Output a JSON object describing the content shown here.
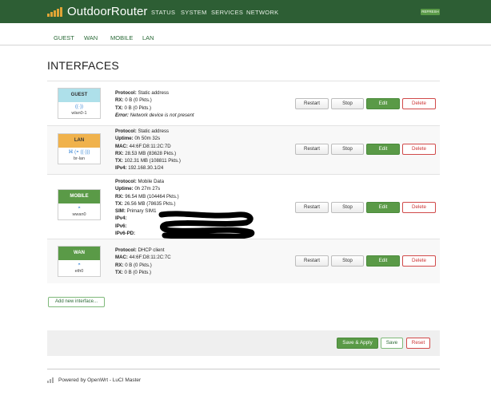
{
  "header": {
    "brand": "OutdoorRouter",
    "nav": [
      "STATUS",
      "SYSTEM",
      "SERVICES",
      "NETWORK"
    ],
    "refresh": "REFRESH"
  },
  "tabs": [
    "GUEST",
    "WAN",
    "MOBILE",
    "LAN"
  ],
  "page_title": "INTERFACES",
  "interfaces": [
    {
      "name": "GUEST",
      "color": "#aee0ea",
      "device": "wlan0-1",
      "icons": "((·))",
      "lines": [
        {
          "k": "Protocol:",
          "v": " Static address"
        },
        {
          "k": "RX:",
          "v": " 0 B (0 Pkts.)"
        },
        {
          "k": "TX:",
          "v": " 0 B (0 Pkts.)"
        },
        {
          "k": "Error:",
          "v": " Network device is not present"
        }
      ]
    },
    {
      "name": "LAN",
      "color": "#f0b24c",
      "device": "br-lan",
      "icons": "⌘ (◓ ((·)))",
      "lines": [
        {
          "k": "Protocol:",
          "v": " Static address"
        },
        {
          "k": "Uptime:",
          "v": " 0h 50m 32s"
        },
        {
          "k": "MAC:",
          "v": " 44:6F:D8:11:2C:7D"
        },
        {
          "k": "RX:",
          "v": " 28.53 MB (83628 Pkts.)"
        },
        {
          "k": "TX:",
          "v": " 102.31 MB (108811 Pkts.)"
        },
        {
          "k": "IPv4:",
          "v": " 192.168.30.1/24"
        }
      ]
    },
    {
      "name": "MOBILE",
      "color": "#5a9a47",
      "device": "wwan0",
      "icons": "◓",
      "lines": [
        {
          "k": "Protocol:",
          "v": " Mobile Data"
        },
        {
          "k": "Uptime:",
          "v": " 0h 27m 27s"
        },
        {
          "k": "RX:",
          "v": " 96.54 MB (104464 Pkts.)"
        },
        {
          "k": "TX:",
          "v": " 26.56 MB (78635 Pkts.)"
        },
        {
          "k": "SIM:",
          "v": " Primary SIM1"
        },
        {
          "k": "IPv4:",
          "v": ""
        },
        {
          "k": "IPv6:",
          "v": ""
        },
        {
          "k": "IPv6-PD:",
          "v": ""
        }
      ]
    },
    {
      "name": "WAN",
      "color": "#5a9a47",
      "device": "eth0",
      "icons": "◓",
      "lines": [
        {
          "k": "Protocol:",
          "v": " DHCP client"
        },
        {
          "k": "MAC:",
          "v": " 44:6F:D8:11:2C:7C"
        },
        {
          "k": "RX:",
          "v": " 0 B (0 Pkts.)"
        },
        {
          "k": "TX:",
          "v": " 0 B (0 Pkts.)"
        }
      ]
    }
  ],
  "row_buttons": {
    "restart": "Restart",
    "stop": "Stop",
    "edit": "Edit",
    "delete": "Delete"
  },
  "add_button": "Add new interface...",
  "footer_buttons": {
    "save_apply": "Save & Apply",
    "save": "Save",
    "reset": "Reset"
  },
  "powered_by": "Powered by OpenWrt - LuCI Master",
  "colors": {
    "header": "#2d5e34",
    "accent": "#5a9a47",
    "logo": "#e0a436",
    "danger": "#c33333"
  }
}
